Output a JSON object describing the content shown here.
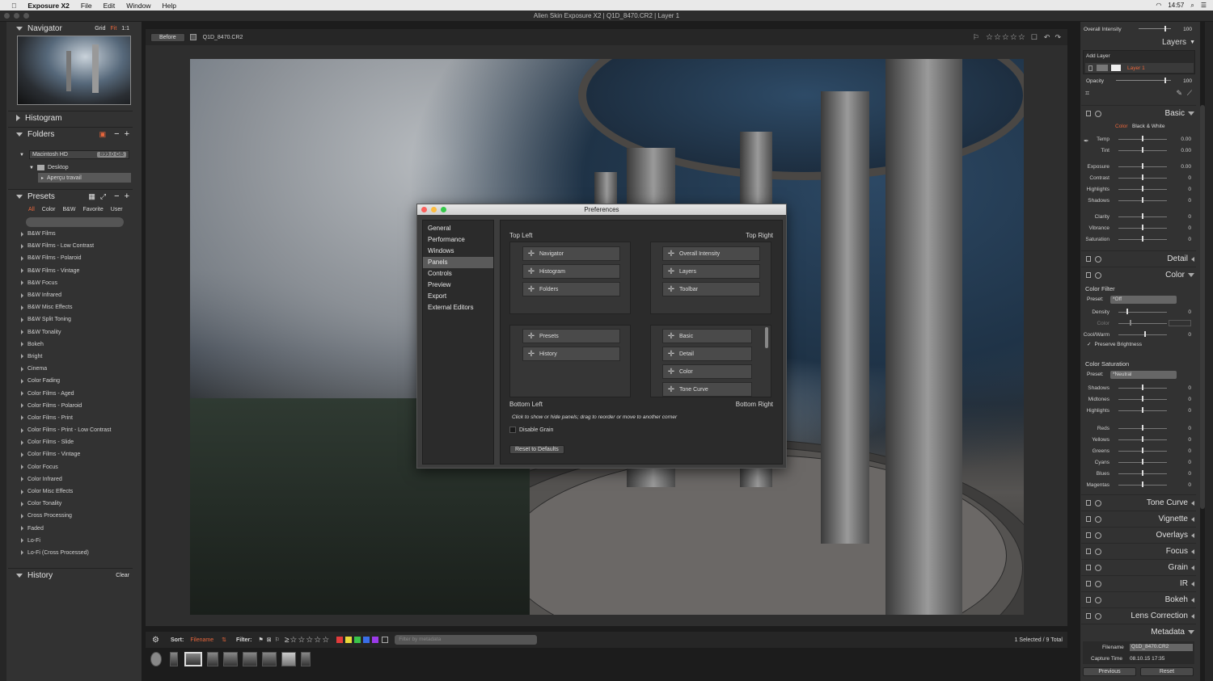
{
  "menubar": {
    "app": "Exposure X2",
    "items": [
      "File",
      "Edit",
      "Window",
      "Help"
    ],
    "time": "14:57"
  },
  "window": {
    "title": "Alien Skin Exposure X2 | Q1D_8470.CR2 | Layer 1"
  },
  "left": {
    "navigator": {
      "title": "Navigator",
      "grid": "Grid",
      "fit": "Fit",
      "one": "1:1"
    },
    "histogram": {
      "title": "Histogram"
    },
    "folders": {
      "title": "Folders",
      "drive": "Macintosh HD",
      "drive_size": "899.0 GB",
      "desktop": "Desktop",
      "folder": "Aperçu travail"
    },
    "presets": {
      "title": "Presets",
      "tabs": [
        "All",
        "Color",
        "B&W",
        "Favorite",
        "User"
      ],
      "items": [
        "B&W Films",
        "B&W Films - Low Contrast",
        "B&W Films - Polaroid",
        "B&W Films - Vintage",
        "B&W Focus",
        "B&W Infrared",
        "B&W Misc Effects",
        "B&W Split Toning",
        "B&W Tonality",
        "Bokeh",
        "Bright",
        "Cinema",
        "Color Fading",
        "Color Films - Aged",
        "Color Films - Polaroid",
        "Color Films - Print",
        "Color Films - Print - Low Contrast",
        "Color Films - Slide",
        "Color Films - Vintage",
        "Color Focus",
        "Color Infrared",
        "Color Misc Effects",
        "Color Tonality",
        "Cross Processing",
        "Faded",
        "Lo-Fi",
        "Lo-Fi (Cross Processed)"
      ]
    },
    "history": {
      "title": "History",
      "clear": "Clear"
    }
  },
  "toolbar": {
    "before": "Before",
    "filename": "Q1D_8470.CR2"
  },
  "dialog": {
    "title": "Preferences",
    "nav": [
      "General",
      "Performance",
      "Windows",
      "Panels",
      "Controls",
      "Preview",
      "Export",
      "External Editors"
    ],
    "selected_nav": "Panels",
    "top_left_label": "Top Left",
    "top_right_label": "Top Right",
    "bottom_left_label": "Bottom Left",
    "bottom_right_label": "Bottom Right",
    "top_left": [
      "Navigator",
      "Histogram",
      "Folders"
    ],
    "top_right": [
      "Overall Intensity",
      "Layers",
      "Toolbar"
    ],
    "bottom_left": [
      "Presets",
      "History"
    ],
    "bottom_right": [
      "Basic",
      "Detail",
      "Color",
      "Tone Curve"
    ],
    "hint": "Click to show or hide panels; drag to reorder or move to another corner",
    "disable_grain": "Disable Grain",
    "reset": "Reset to Defaults"
  },
  "bottombar": {
    "sort_label": "Sort:",
    "sort_value": "Filename",
    "filter_label": "Filter:",
    "filter_placeholder": "Filter by metadata",
    "status": "1 Selected / 9 Total",
    "colors": [
      "#e23b3b",
      "#e8d83a",
      "#3ac44a",
      "#3a6ee8",
      "#9b3ae8"
    ]
  },
  "right": {
    "overall": {
      "label": "Overall Intensity",
      "value": "100"
    },
    "layers": {
      "title": "Layers",
      "add": "Add Layer",
      "layer1": "Layer 1",
      "opacity_label": "Opacity",
      "opacity_value": "100"
    },
    "basic": {
      "title": "Basic",
      "mode_color": "Color",
      "mode_bw": "Black & White",
      "rows": [
        {
          "l": "Temp",
          "v": "0.00"
        },
        {
          "l": "Tint",
          "v": "0.00"
        },
        {
          "l": "Exposure",
          "v": "0.00"
        },
        {
          "l": "Contrast",
          "v": "0"
        },
        {
          "l": "Highlights",
          "v": "0"
        },
        {
          "l": "Shadows",
          "v": "0"
        },
        {
          "l": "Clarity",
          "v": "0"
        },
        {
          "l": "Vibrance",
          "v": "0"
        },
        {
          "l": "Saturation",
          "v": "0"
        }
      ]
    },
    "detail": {
      "title": "Detail"
    },
    "color": {
      "title": "Color",
      "filter_title": "Color Filter",
      "preset_label": "Preset:",
      "filter_preset": "*Off",
      "density": "Density",
      "density_v": "0",
      "color_label": "Color",
      "coolwarm": "Cool/Warm",
      "coolwarm_v": "0",
      "preserve": "Preserve Brightness",
      "sat_title": "Color Saturation",
      "sat_preset": "*Neutral",
      "sat_rows": [
        {
          "l": "Shadows",
          "v": "0"
        },
        {
          "l": "Midtones",
          "v": "0"
        },
        {
          "l": "Highlights",
          "v": "0"
        },
        {
          "l": "Reds",
          "v": "0"
        },
        {
          "l": "Yellows",
          "v": "0"
        },
        {
          "l": "Greens",
          "v": "0"
        },
        {
          "l": "Cyans",
          "v": "0"
        },
        {
          "l": "Blues",
          "v": "0"
        },
        {
          "l": "Magentas",
          "v": "0"
        }
      ]
    },
    "panels": [
      "Tone Curve",
      "Vignette",
      "Overlays",
      "Focus",
      "Grain",
      "IR",
      "Bokeh",
      "Lens Correction"
    ],
    "metadata": {
      "title": "Metadata",
      "filename_label": "Filename",
      "filename": "Q1D_8470.CR2",
      "capture_label": "Capture Time",
      "capture": "08.10.15 17:35"
    },
    "previous": "Previous",
    "reset": "Reset"
  }
}
